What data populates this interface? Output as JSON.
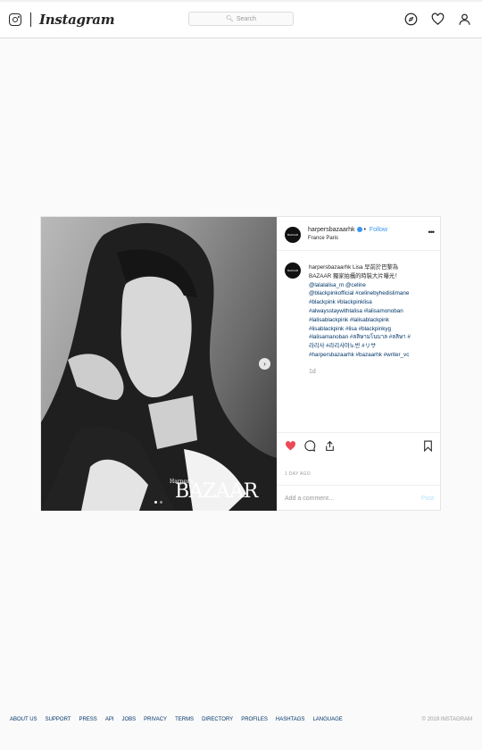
{
  "app": {
    "wordmark": "Instagram"
  },
  "search": {
    "placeholder": "Search"
  },
  "post": {
    "username": "harpersbazaarhk",
    "follow_label": "Follow",
    "location": "France Paris",
    "avatar_text": "BAZAAR",
    "caption_lines": [
      "harpersbazaarhk Lisa 早前於巴黎為",
      "BAZAAR 獨家拍攝的時裝大片曝光！",
      "@lalalalisa_m @celine",
      "@blackpinkofficial #celinebyhedislimane",
      "#blackpink #blackpinklisa",
      "#alwaysstaywithlalisa #lalisamonoban",
      "#lalisablackpink #lalisablackpink",
      "#lisablackpink #lisa #blackpinkyg",
      "#lalisamanoban #ลลิษามโนบาล #ลลิษา #",
      "라리사 #라리사마노반 #リサ",
      "#harpersbazaarhk #bazaarhk #writer_vc"
    ],
    "age": "1d",
    "day_ago": "1 DAY AGO",
    "comment_placeholder": "Add a comment…",
    "post_label": "Post",
    "image_watermark": "BAZAAR",
    "image_watermark_small": "Harper's"
  },
  "footer": {
    "links": [
      "ABOUT US",
      "SUPPORT",
      "PRESS",
      "API",
      "JOBS",
      "PRIVACY",
      "TERMS",
      "DIRECTORY",
      "PROFILES",
      "HASHTAGS",
      "LANGUAGE"
    ],
    "copyright": "© 2019 INSTAGRAM"
  },
  "icons": {
    "logo": "instagram-glyph-icon",
    "explore": "compass-icon",
    "activity": "heart-outline-icon",
    "profile": "person-icon",
    "like": "heart-filled-icon",
    "comment": "comment-bubble-icon",
    "share": "share-icon",
    "save": "bookmark-icon",
    "more": "more-options-icon",
    "next": "chevron-right-icon"
  },
  "colors": {
    "accent": "#3897f0",
    "like": "#ed4956",
    "link": "#003569"
  }
}
